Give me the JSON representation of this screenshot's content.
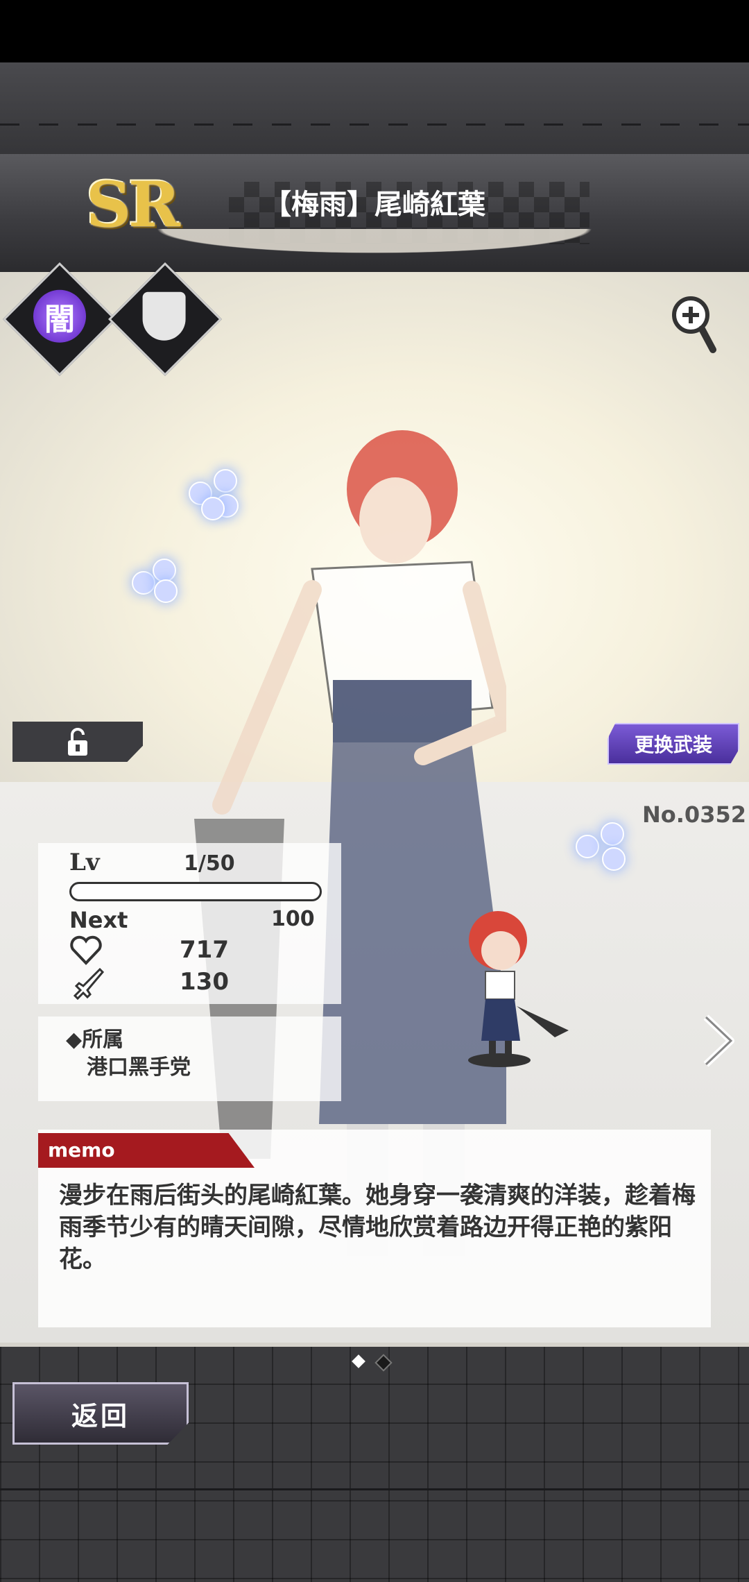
{
  "card": {
    "rarity": "SR",
    "title": "【梅雨】尾崎紅葉",
    "number": "No.0352"
  },
  "badges": {
    "attribute_glyph": "闇",
    "attribute_icon": "dark-attribute-icon",
    "type_icon": "shield-icon"
  },
  "buttons": {
    "change_outfit": "更换武装",
    "back": "返回",
    "lock_icon": "unlock-icon",
    "zoom_icon": "zoom-in-icon",
    "next_icon": "chevron-right-icon"
  },
  "stats": {
    "lv_label": "Lv",
    "lv_value": "1/50",
    "exp_progress": 0,
    "next_label": "Next",
    "next_value": "100",
    "hp_icon": "heart-icon",
    "hp_value": "717",
    "atk_icon": "sword-icon",
    "atk_value": "130"
  },
  "affiliation": {
    "label": "◆所属",
    "value": "港口黑手党"
  },
  "memo": {
    "tag": "memo",
    "text": "漫步在雨后街头的尾崎紅葉。她身穿一袭清爽的洋装，趁着梅雨季节少有的晴天间隙，尽情地欣赏着路边开得正艳的紫阳花。"
  },
  "pager": {
    "pages": 2,
    "active": 1
  },
  "colors": {
    "rarity_gold": "#e8c24a",
    "memo_red": "#a51a1f",
    "change_btn_purple": "#5b3cc0",
    "attribute_purple": "#7b3fe0"
  }
}
